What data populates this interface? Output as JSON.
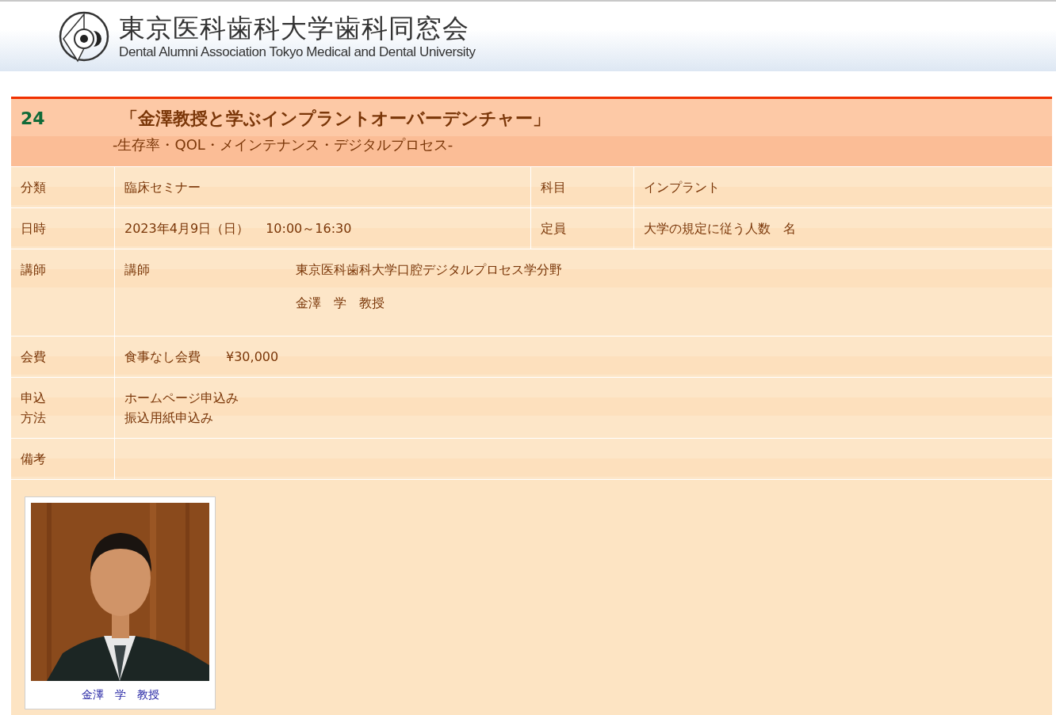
{
  "header": {
    "title": "東京医科歯科大学歯科同窓会",
    "subtitle": "Dental Alumni Association Tokyo Medical and Dental University"
  },
  "event": {
    "number": "24",
    "title": "「金澤教授と学ぶインプラントオーバーデンチャー」",
    "subtitle": "-生存率・QOL・メインテナンス・デジタルプロセス-",
    "rows": [
      {
        "kind": "split",
        "label": "分類",
        "value": "臨床セミナー",
        "side_label": "科目",
        "side_value": "インプラント"
      },
      {
        "kind": "split",
        "label": "日時",
        "value": "2023年4月9日（日）　 10:00～16:30",
        "side_label": "定員",
        "side_value": "大学の規定に従う人数　名"
      },
      {
        "kind": "lecturer",
        "label": "講師",
        "role": "講師",
        "affiliation": "東京医科歯科大学口腔デジタルプロセス学分野",
        "name": "金澤　学　教授"
      },
      {
        "kind": "text",
        "label": "会費",
        "lines": [
          "食事なし会費　　¥30,000"
        ]
      },
      {
        "kind": "text",
        "label": "申込方法",
        "lines": [
          "ホームページ申込み",
          "振込用紙申込み"
        ]
      },
      {
        "kind": "text",
        "label": "備考"
      }
    ],
    "photo": {
      "kind": "picture",
      "caption": "金澤　学　教授"
    }
  }
}
